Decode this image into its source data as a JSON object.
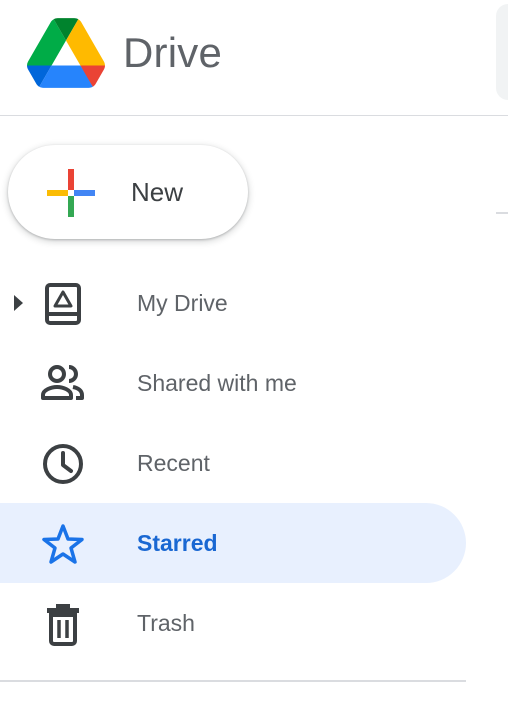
{
  "header": {
    "product_name": "Drive",
    "logo_icon": "google-drive-logo"
  },
  "new_button": {
    "label": "New",
    "icon": "plus-multicolor-icon"
  },
  "nav": {
    "items": [
      {
        "label": "My Drive",
        "icon": "my-drive-icon",
        "expandable": true,
        "active": false
      },
      {
        "label": "Shared with me",
        "icon": "people-icon",
        "active": false
      },
      {
        "label": "Recent",
        "icon": "clock-icon",
        "active": false
      },
      {
        "label": "Starred",
        "icon": "star-icon",
        "active": true
      },
      {
        "label": "Trash",
        "icon": "trash-icon",
        "active": false
      }
    ]
  },
  "colors": {
    "active_bg": "#e8f0fe",
    "active_text": "#1967d2",
    "text": "#5f6368",
    "divider": "#dadce0"
  }
}
